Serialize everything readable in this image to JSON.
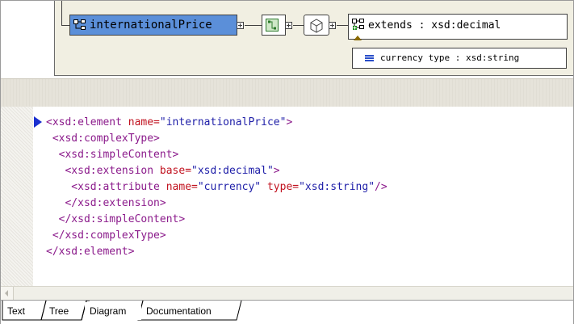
{
  "diagram": {
    "element_label": "internationalPrice",
    "extension_label": "extends : xsd:decimal",
    "attribute_label": "currency type : xsd:string",
    "icons": [
      "element-icon",
      "sequence-icon",
      "complex-type-icon",
      "attribute-icon"
    ],
    "colors": {
      "element_fill": "#5b8fd9",
      "panel_bg": "#f1efe2"
    }
  },
  "code": {
    "lines": [
      [
        {
          "c": "tag",
          "t": "<xsd:element "
        },
        {
          "c": "att",
          "t": "name="
        },
        {
          "c": "val",
          "t": "\"internationalPrice\""
        },
        {
          "c": "tag",
          "t": ">"
        }
      ],
      [
        {
          "c": "tag",
          "t": " <xsd:complexType>"
        }
      ],
      [
        {
          "c": "tag",
          "t": "  <xsd:simpleContent>"
        }
      ],
      [
        {
          "c": "tag",
          "t": "   <xsd:extension "
        },
        {
          "c": "att",
          "t": "base="
        },
        {
          "c": "val",
          "t": "\"xsd:decimal\""
        },
        {
          "c": "tag",
          "t": ">"
        }
      ],
      [
        {
          "c": "tag",
          "t": "    <xsd:attribute "
        },
        {
          "c": "att",
          "t": "name="
        },
        {
          "c": "val",
          "t": "\"currency\""
        },
        {
          "c": "tag",
          "t": " "
        },
        {
          "c": "att",
          "t": "type="
        },
        {
          "c": "val",
          "t": "\"xsd:string\""
        },
        {
          "c": "tag",
          "t": "/>"
        }
      ],
      [
        {
          "c": "tag",
          "t": "   </xsd:extension>"
        }
      ],
      [
        {
          "c": "tag",
          "t": "  </xsd:simpleContent>"
        }
      ],
      [
        {
          "c": "tag",
          "t": " </xsd:complexType>"
        }
      ],
      [
        {
          "c": "tag",
          "t": "</xsd:element>"
        }
      ]
    ],
    "colors": {
      "tag": "#8b1a8b",
      "attribute": "#c1121f",
      "value": "#1e1ea8",
      "marker": "#1a2fd0"
    }
  },
  "tabs": [
    {
      "label": "Text"
    },
    {
      "label": "Tree"
    },
    {
      "label": "Diagram",
      "active": true
    },
    {
      "label": "Documentation"
    }
  ]
}
